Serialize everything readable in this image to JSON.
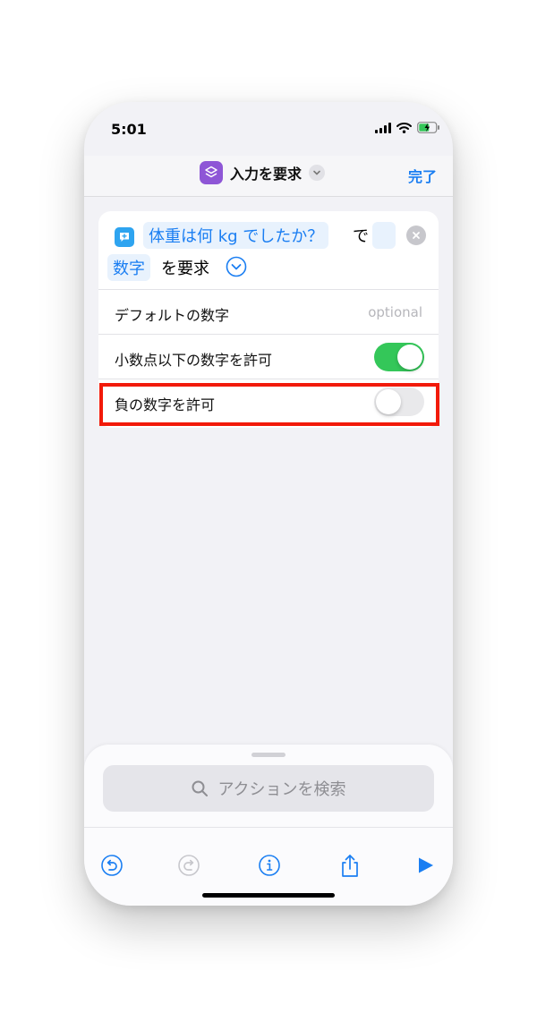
{
  "status": {
    "time": "5:01"
  },
  "nav": {
    "title": "入力を要求",
    "done": "完了"
  },
  "action": {
    "prompt_token": "体重は何 kg でしたか？",
    "word_with": "で",
    "type_token": "数字",
    "word_ask": "を要求"
  },
  "rows": [
    {
      "label": "デフォルトの数字",
      "placeholder": "optional"
    },
    {
      "label": "小数点以下の数字を許可",
      "toggle": true
    },
    {
      "label": "負の数字を許可",
      "toggle": false
    }
  ],
  "search": {
    "placeholder": "アクションを検索"
  },
  "colors": {
    "accent": "#1a7ef2",
    "toggle_on": "#34c759",
    "highlight": "#f21a0a",
    "app_icon": "#8e56d6"
  }
}
